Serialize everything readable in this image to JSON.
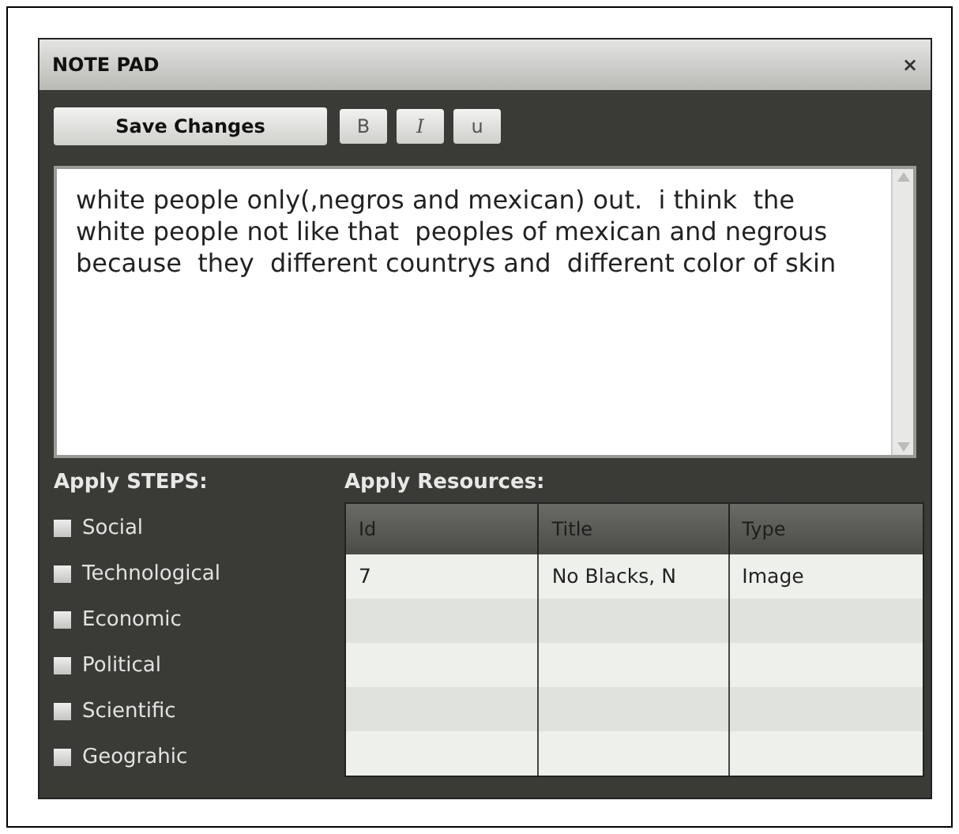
{
  "window": {
    "title": "NOTE PAD",
    "close": "×"
  },
  "toolbar": {
    "save": "Save Changes",
    "format_buttons": [
      {
        "kind": "bold",
        "label": "B"
      },
      {
        "kind": "italic",
        "label": "I"
      },
      {
        "kind": "underline",
        "label": "u"
      }
    ]
  },
  "note": {
    "value": "white people only(,negros and mexican) out.  i think  the white people not like that  peoples of mexican and negrous because  they  different countrys and  different color of skin"
  },
  "steps": {
    "heading": "Apply STEPS:",
    "items": [
      {
        "label": "Social",
        "checked": false
      },
      {
        "label": "Technological",
        "checked": false
      },
      {
        "label": "Economic",
        "checked": false
      },
      {
        "label": "Political",
        "checked": false
      },
      {
        "label": "Scientific",
        "checked": false
      },
      {
        "label": "Geograhic",
        "checked": false
      }
    ]
  },
  "resources": {
    "heading": "Apply Resources:",
    "columns": [
      "Id",
      "Title",
      "Type"
    ],
    "rows": [
      {
        "cells": [
          "7",
          "No Blacks, N",
          "Image"
        ]
      }
    ]
  }
}
